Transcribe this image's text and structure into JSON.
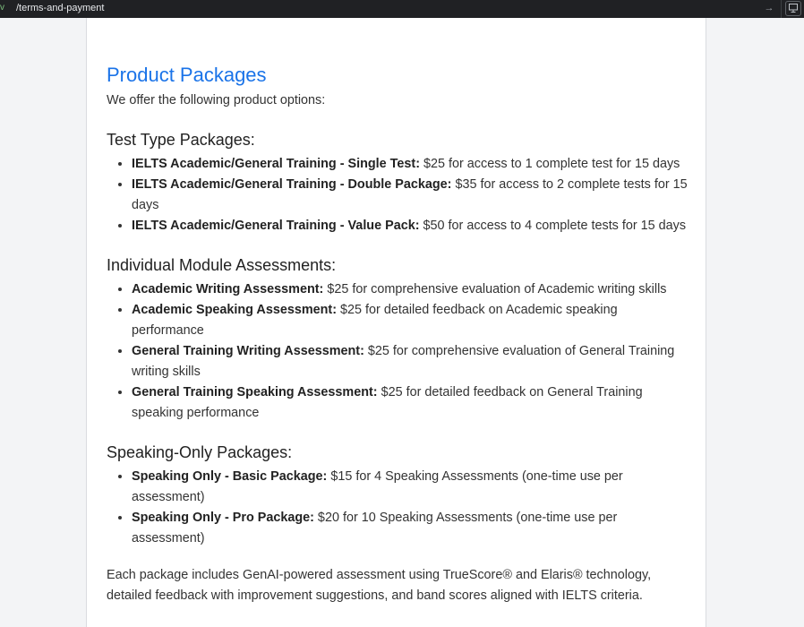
{
  "browser": {
    "path": "/terms-and-payment",
    "left_glyph": "v",
    "go_glyph": "→"
  },
  "content": {
    "title": "Product Packages",
    "intro": "We offer the following product options:",
    "sections": [
      {
        "heading": "Test Type Packages:",
        "items": [
          {
            "name": "IELTS Academic/General Training - Single Test:",
            "desc": " $25 for access to 1 complete test for 15 days"
          },
          {
            "name": "IELTS Academic/General Training - Double Package:",
            "desc": " $35 for access to 2 complete tests for 15 days"
          },
          {
            "name": "IELTS Academic/General Training - Value Pack:",
            "desc": " $50 for access to 4 complete tests for 15 days"
          }
        ]
      },
      {
        "heading": "Individual Module Assessments:",
        "items": [
          {
            "name": "Academic Writing Assessment:",
            "desc": " $25 for comprehensive evaluation of Academic writing skills"
          },
          {
            "name": "Academic Speaking Assessment:",
            "desc": " $25 for detailed feedback on Academic speaking performance"
          },
          {
            "name": "General Training Writing Assessment:",
            "desc": " $25 for comprehensive evaluation of General Training writing skills"
          },
          {
            "name": "General Training Speaking Assessment:",
            "desc": " $25 for detailed feedback on General Training speaking performance"
          }
        ]
      },
      {
        "heading": "Speaking-Only Packages:",
        "items": [
          {
            "name": "Speaking Only - Basic Package:",
            "desc": " $15 for 4 Speaking Assessments (one-time use per assessment)"
          },
          {
            "name": "Speaking Only - Pro Package:",
            "desc": " $20 for 10 Speaking Assessments (one-time use per assessment)"
          }
        ]
      }
    ],
    "footer": "Each package includes GenAI-powered assessment using TrueScore® and Elaris® technology, detailed feedback with improvement suggestions, and band scores aligned with IELTS criteria."
  },
  "colors": {
    "accent": "#1a73e8",
    "text": "#333333",
    "topbar": "#202124"
  }
}
